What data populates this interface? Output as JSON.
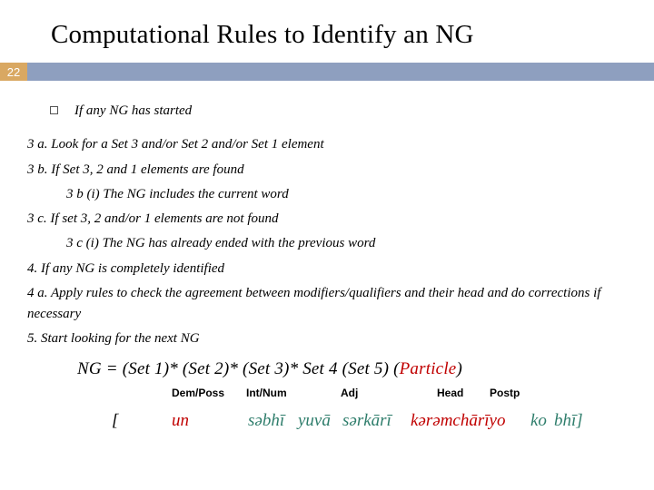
{
  "page_number": "22",
  "title": "Computational Rules to Identify an NG",
  "bullet": "If any NG has started",
  "rules": {
    "r3a": "3 a. Look for a Set 3 and/or Set 2 and/or Set 1 element",
    "r3b": "3 b. If Set 3, 2 and 1 elements are found",
    "r3bi": "3 b (i) The NG includes the current word",
    "r3c": "3 c. If set 3, 2 and/or 1 elements are not found",
    "r3ci": "3 c (i) The NG has already ended with the previous word",
    "r4": " 4. If any NG is completely identified",
    "r4a": "4 a. Apply rules to check the agreement between modifiers/qualifiers and their head and do corrections if necessary",
    "r5": "5. Start looking for the next NG"
  },
  "formula": {
    "prefix": "NG  =  (Set 1)*  (Set 2)*  (Set 3)*  Set 4  (Set 5) (",
    "particle": "Particle",
    "suffix": ")"
  },
  "labels": {
    "l1": "Dem/Poss",
    "l2": "Int/Num",
    "l3": "Adj",
    "l4": "Head",
    "l5": "Postp"
  },
  "example": {
    "bracket_open": "[",
    "w1": "un",
    "w2": "səbhī",
    "w3": "yuvā",
    "w4": "sərkārī",
    "w5": "kərəmchārīyo",
    "w6": "ko",
    "w7": "bhī",
    "bracket_close": "]"
  }
}
